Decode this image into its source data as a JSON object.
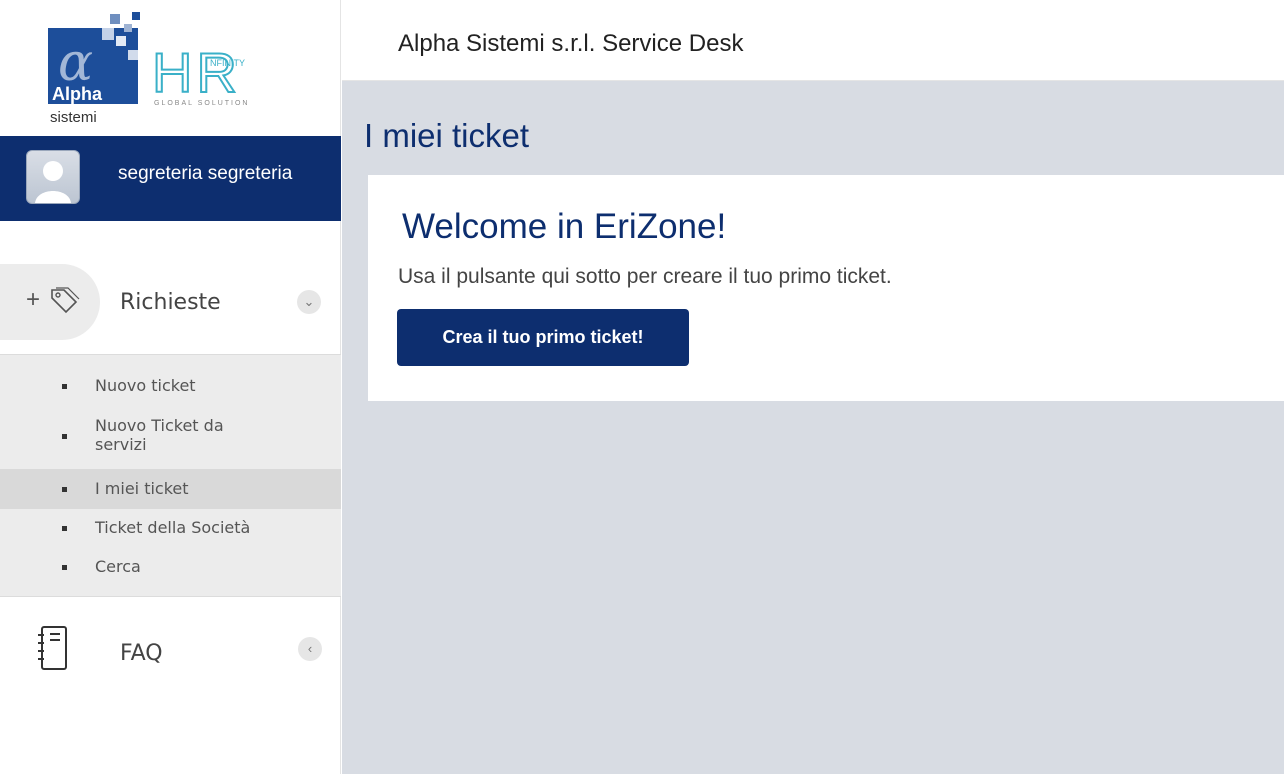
{
  "brand": {
    "logo_text_alpha": "Alpha",
    "logo_text_sistemi": "sistemi",
    "logo_text_hr": "HR",
    "logo_text_infinity": "NFINITY",
    "logo_text_global": "GLOBAL SOLUTION",
    "primary_color": "#0d2e6f"
  },
  "user": {
    "name": "segreteria segreteria"
  },
  "sidebar": {
    "richieste": {
      "label": "Richieste",
      "icon": "tag-plus-icon"
    },
    "submenu": [
      {
        "label": "Nuovo ticket"
      },
      {
        "label": "Nuovo Ticket da servizi"
      },
      {
        "label": "I miei ticket",
        "active": true
      },
      {
        "label": "Ticket della Società"
      },
      {
        "label": "Cerca"
      }
    ],
    "faq": {
      "label": "FAQ",
      "icon": "notebook-icon"
    }
  },
  "header": {
    "title": "Alpha Sistemi s.r.l. Service Desk"
  },
  "main": {
    "page_title": "I miei ticket",
    "welcome_title": "Welcome in EriZone!",
    "welcome_desc": "Usa il pulsante qui sotto per creare il tuo primo ticket.",
    "cta_label": "Crea il tuo primo ticket!"
  }
}
